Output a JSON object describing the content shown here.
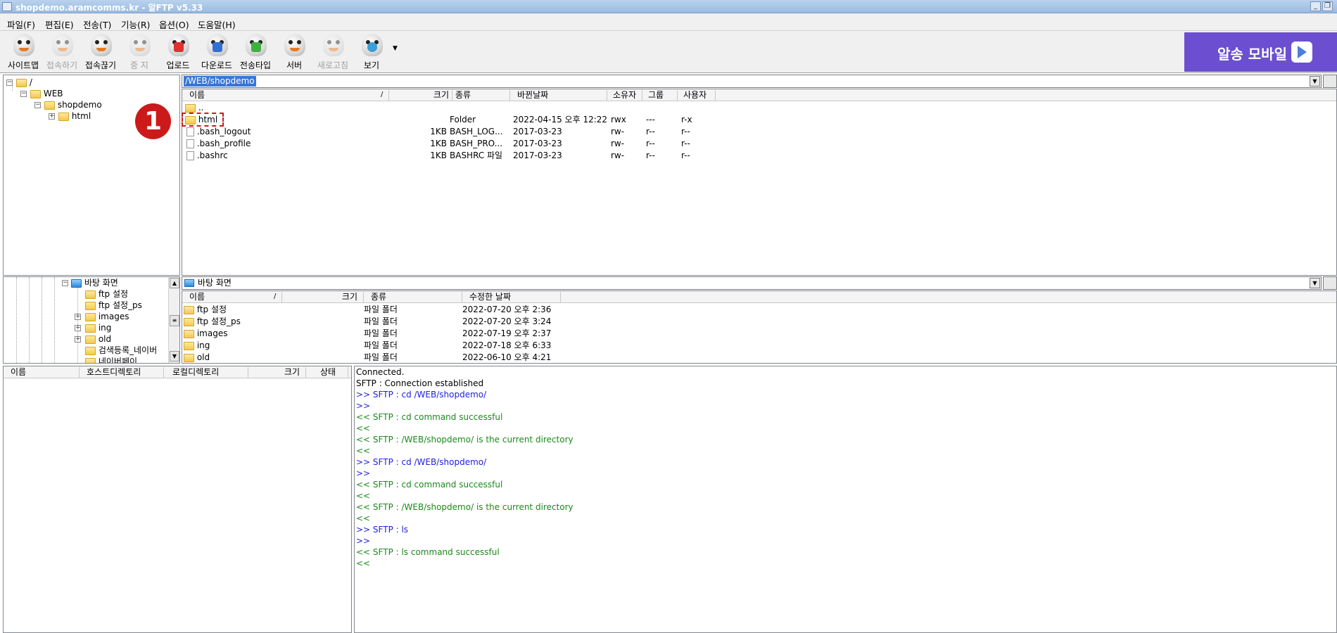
{
  "window": {
    "title": "shopdemo.aramcomms.kr - 알FTP v5.33"
  },
  "menu": [
    "파일(F)",
    "편집(E)",
    "전송(T)",
    "기능(R)",
    "옵션(O)",
    "도움말(H)"
  ],
  "toolbar": [
    {
      "label": "사이트맵",
      "enabled": true
    },
    {
      "label": "접속하기",
      "enabled": false
    },
    {
      "label": "접속끊기",
      "enabled": true
    },
    {
      "label": "중 지",
      "enabled": false
    },
    {
      "label": "업로드",
      "enabled": true
    },
    {
      "label": "다운로드",
      "enabled": true
    },
    {
      "label": "전송타입",
      "enabled": true
    },
    {
      "label": "서버",
      "enabled": true
    },
    {
      "label": "새로고침",
      "enabled": false
    },
    {
      "label": "보기",
      "enabled": true
    }
  ],
  "ad": {
    "text": "알송 모바일"
  },
  "annotation": {
    "step": "1"
  },
  "remote_tree": [
    "/",
    "WEB",
    "shopdemo",
    "html"
  ],
  "remote_path": "/WEB/shopdemo",
  "remote_headers": [
    "이름",
    "크기",
    "종류",
    "바뀐날짜",
    "소유자",
    "그룹",
    "사용자"
  ],
  "remote_files": [
    {
      "name": "..",
      "size": "",
      "type": "",
      "date": "",
      "owner": "",
      "group": "",
      "user": "",
      "icon": "folder"
    },
    {
      "name": "html",
      "size": "",
      "type": "Folder",
      "date": "2022-04-15 오후 12:22",
      "owner": "rwx",
      "group": "---",
      "user": "r-x",
      "icon": "folder"
    },
    {
      "name": ".bash_logout",
      "size": "1KB",
      "type": "BASH_LOG...",
      "date": "2017-03-23",
      "owner": "rw-",
      "group": "r--",
      "user": "r--",
      "icon": "file"
    },
    {
      "name": ".bash_profile",
      "size": "1KB",
      "type": "BASH_PRO...",
      "date": "2017-03-23",
      "owner": "rw-",
      "group": "r--",
      "user": "r--",
      "icon": "file"
    },
    {
      "name": ".bashrc",
      "size": "1KB",
      "type": "BASHRC 파일",
      "date": "2017-03-23",
      "owner": "rw-",
      "group": "r--",
      "user": "r--",
      "icon": "file"
    }
  ],
  "local_tree": [
    {
      "name": "바탕 화면",
      "expander": "-"
    },
    {
      "name": "ftp 설정",
      "expander": ""
    },
    {
      "name": "ftp 설정_ps",
      "expander": ""
    },
    {
      "name": "images",
      "expander": "+"
    },
    {
      "name": "ing",
      "expander": "+"
    },
    {
      "name": "old",
      "expander": "+"
    },
    {
      "name": "검색등록_네이버",
      "expander": ""
    },
    {
      "name": "네이버페이",
      "expander": ""
    }
  ],
  "local_path": "바탕 화면",
  "local_headers": [
    "이름",
    "크기",
    "종류",
    "수정한 날짜"
  ],
  "local_files": [
    {
      "name": "ftp 설정",
      "size": "",
      "type": "파일 폴더",
      "date": "2022-07-20 오후 2:36"
    },
    {
      "name": "ftp 설정_ps",
      "size": "",
      "type": "파일 폴더",
      "date": "2022-07-20 오후 3:24"
    },
    {
      "name": "images",
      "size": "",
      "type": "파일 폴더",
      "date": "2022-07-19 오후 2:37"
    },
    {
      "name": "ing",
      "size": "",
      "type": "파일 폴더",
      "date": "2022-07-18 오후 6:33"
    },
    {
      "name": "old",
      "size": "",
      "type": "파일 폴더",
      "date": "2022-06-10 오후 4:21"
    }
  ],
  "queue_headers": [
    "이름",
    "호스트디렉토리",
    "로컬디렉토리",
    "크기",
    "상태"
  ],
  "log": [
    {
      "text": "Connected.",
      "kind": 0
    },
    {
      "text": "SFTP : Connection established",
      "kind": 0
    },
    {
      "text": ">> SFTP : cd /WEB/shopdemo/",
      "kind": 1
    },
    {
      "text": ">>",
      "kind": 1
    },
    {
      "text": "<< SFTP : cd command successful",
      "kind": 2
    },
    {
      "text": "<<",
      "kind": 2
    },
    {
      "text": "<< SFTP : /WEB/shopdemo/ is the current directory",
      "kind": 2
    },
    {
      "text": "<<",
      "kind": 2
    },
    {
      "text": ">> SFTP : cd /WEB/shopdemo/",
      "kind": 1
    },
    {
      "text": ">>",
      "kind": 1
    },
    {
      "text": "<< SFTP : cd command successful",
      "kind": 2
    },
    {
      "text": "<<",
      "kind": 2
    },
    {
      "text": "<< SFTP : /WEB/shopdemo/ is the current directory",
      "kind": 2
    },
    {
      "text": "<<",
      "kind": 2
    },
    {
      "text": ">> SFTP : ls",
      "kind": 1
    },
    {
      "text": ">>",
      "kind": 1
    },
    {
      "text": "<< SFTP : ls command successful",
      "kind": 2
    },
    {
      "text": "<<",
      "kind": 2
    }
  ]
}
